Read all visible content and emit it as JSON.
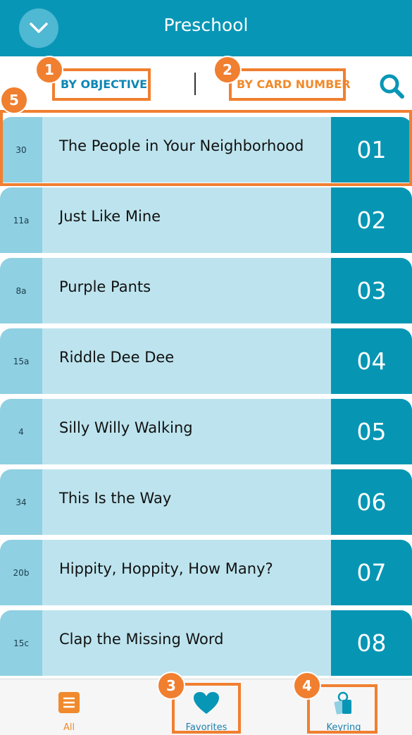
{
  "header": {
    "title": "Preschool",
    "collapse_icon": "chevron-down-icon"
  },
  "sortbar": {
    "by_objective": "BY OBJECTIVE",
    "by_card_number": "BY CARD NUMBER",
    "search_icon": "search-icon",
    "active": "by_card_number"
  },
  "cards": [
    {
      "code": "30",
      "title": "The People in Your Neighborhood",
      "number": "01"
    },
    {
      "code": "11a",
      "title": "Just Like Mine",
      "number": "02"
    },
    {
      "code": "8a",
      "title": "Purple Pants",
      "number": "03"
    },
    {
      "code": "15a",
      "title": "Riddle Dee Dee",
      "number": "04"
    },
    {
      "code": "4",
      "title": "Silly Willy Walking",
      "number": "05"
    },
    {
      "code": "34",
      "title": "This Is the Way",
      "number": "06"
    },
    {
      "code": "20b",
      "title": "Hippity, Hoppity, How Many?",
      "number": "07"
    },
    {
      "code": "15c",
      "title": "Clap the Missing Word",
      "number": "08"
    }
  ],
  "tabs": [
    {
      "label": "All",
      "icon": "list-icon",
      "active": true
    },
    {
      "label": "Favorites",
      "icon": "heart-icon",
      "active": false
    },
    {
      "label": "Keyring",
      "icon": "keyring-icon",
      "active": false
    }
  ],
  "annotations": [
    "1",
    "2",
    "3",
    "4",
    "5"
  ],
  "colors": {
    "brand": "#0896b6",
    "accent": "#f08a2c",
    "annotation": "#f07f30"
  }
}
